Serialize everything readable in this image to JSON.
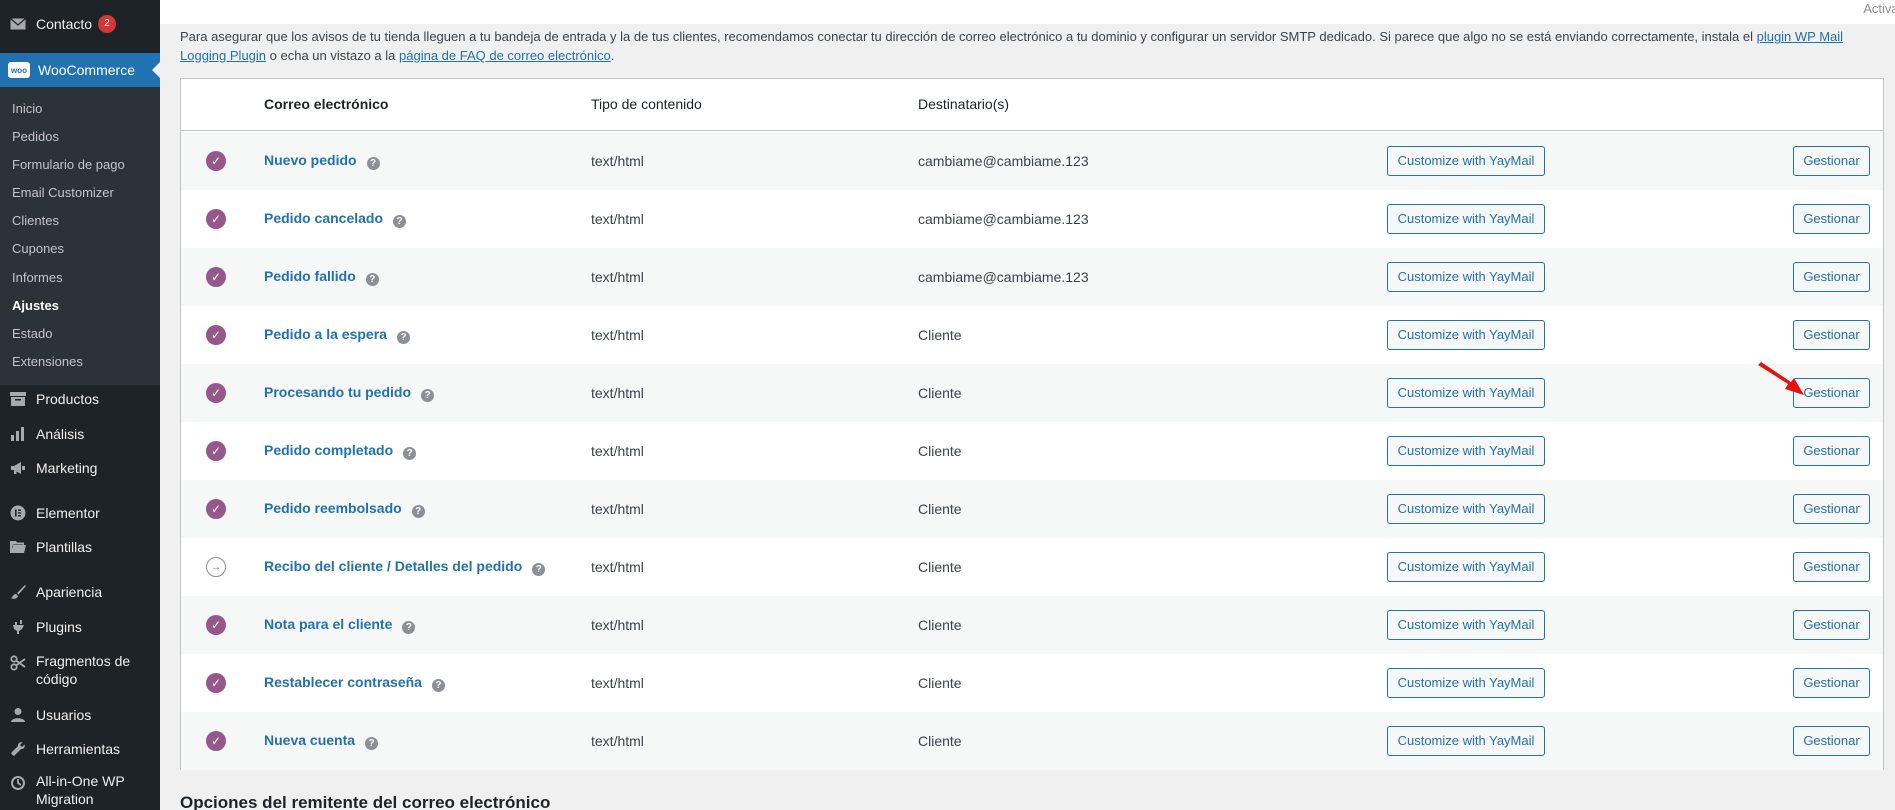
{
  "sidebar": {
    "top_items": [
      {
        "label": "Contacto",
        "icon": "mail-icon",
        "badge": "2"
      },
      {
        "label": "WooCommerce",
        "icon": "woo-logo"
      }
    ],
    "woo_logo_text": "woo",
    "submenu": [
      {
        "label": "Inicio"
      },
      {
        "label": "Pedidos"
      },
      {
        "label": "Formulario de pago"
      },
      {
        "label": "Email Customizer"
      },
      {
        "label": "Clientes"
      },
      {
        "label": "Cupones"
      },
      {
        "label": "Informes"
      },
      {
        "label": "Ajustes",
        "current": true
      },
      {
        "label": "Estado"
      },
      {
        "label": "Extensiones"
      }
    ],
    "menu_items": [
      {
        "label": "Productos",
        "icon": "archive-icon"
      },
      {
        "label": "Análisis",
        "icon": "chart-bar-icon"
      },
      {
        "label": "Marketing",
        "icon": "megaphone-icon"
      },
      {
        "label": "Elementor",
        "icon": "elementor-icon"
      },
      {
        "label": "Plantillas",
        "icon": "folder-icon"
      },
      {
        "label": "Apariencia",
        "icon": "paintbrush-icon"
      },
      {
        "label": "Plugins",
        "icon": "plugin-icon"
      },
      {
        "label": "Fragmentos de",
        "label2": "código",
        "icon": "scissors-icon"
      },
      {
        "label": "Usuarios",
        "icon": "user-icon"
      },
      {
        "label": "Herramientas",
        "icon": "wrench-icon"
      },
      {
        "label": "All-in-One WP",
        "label2": "Migration",
        "icon": "migration-icon"
      }
    ]
  },
  "topbar": {
    "activate_text": "Activar"
  },
  "notice": {
    "text_before": "Para asegurar que los avisos de tu tienda lleguen a tu bandeja de entrada y la de tus clientes, recomendamos conectar tu dirección de correo electrónico a tu dominio y configurar un servidor SMTP dedicado. Si parece que algo no se está enviando correctamente, instala el ",
    "link1": "plugin WP Mail Logging Plugin",
    "text_middle": " o echa un vistazo a la ",
    "link2": "página de FAQ de correo electrónico",
    "text_after": "."
  },
  "table": {
    "headers": {
      "email": "Correo electrónico",
      "content_type": "Tipo de contenido",
      "recipients": "Destinatario(s)"
    },
    "yaymail_label": "Customize with YayMail",
    "manage_label": "Gestionar",
    "rows": [
      {
        "name": "Nuevo pedido",
        "content_type": "text/html",
        "recipient": "cambiame@cambiame.123",
        "status": "enabled"
      },
      {
        "name": "Pedido cancelado",
        "content_type": "text/html",
        "recipient": "cambiame@cambiame.123",
        "status": "enabled"
      },
      {
        "name": "Pedido fallido",
        "content_type": "text/html",
        "recipient": "cambiame@cambiame.123",
        "status": "enabled"
      },
      {
        "name": "Pedido a la espera",
        "content_type": "text/html",
        "recipient": "Cliente",
        "status": "enabled"
      },
      {
        "name": "Procesando tu pedido",
        "content_type": "text/html",
        "recipient": "Cliente",
        "status": "enabled"
      },
      {
        "name": "Pedido completado",
        "content_type": "text/html",
        "recipient": "Cliente",
        "status": "enabled"
      },
      {
        "name": "Pedido reembolsado",
        "content_type": "text/html",
        "recipient": "Cliente",
        "status": "enabled"
      },
      {
        "name": "Recibo del cliente / Detalles del pedido",
        "content_type": "text/html",
        "recipient": "Cliente",
        "status": "manual"
      },
      {
        "name": "Nota para el cliente",
        "content_type": "text/html",
        "recipient": "Cliente",
        "status": "enabled"
      },
      {
        "name": "Restablecer contraseña",
        "content_type": "text/html",
        "recipient": "Cliente",
        "status": "enabled"
      },
      {
        "name": "Nueva cuenta",
        "content_type": "text/html",
        "recipient": "Cliente",
        "status": "enabled"
      }
    ]
  },
  "sender_heading": "Opciones del remitente del correo electrónico",
  "colors": {
    "accent": "#2271b1",
    "woo_purple": "#96588a",
    "sidebar_bg": "#1d2327",
    "arrow_red": "#e81010"
  }
}
